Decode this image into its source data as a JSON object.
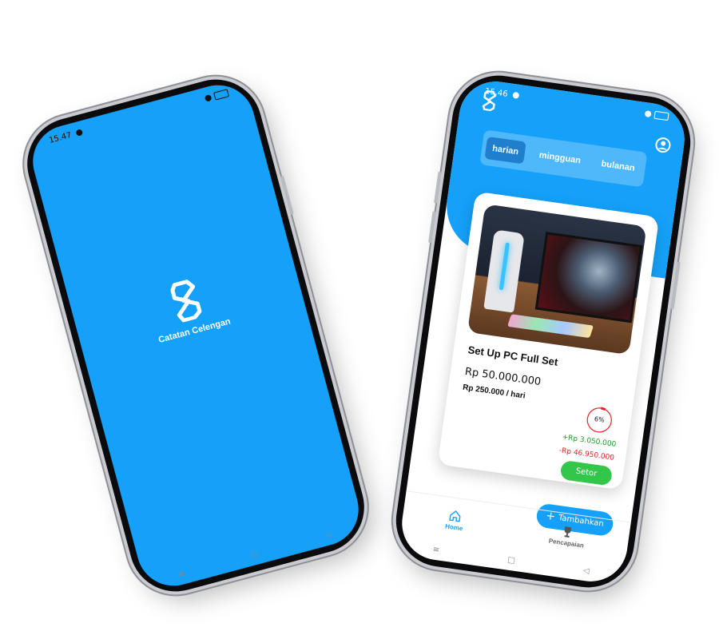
{
  "splash": {
    "status_time": "15.47",
    "app_name": "Catatan Celengan",
    "icon": "app-logo-icon"
  },
  "home": {
    "status_time": "15.46",
    "tabs": [
      {
        "label": "harian",
        "active": true
      },
      {
        "label": "mingguan",
        "active": false
      },
      {
        "label": "bulanan",
        "active": false
      }
    ],
    "card": {
      "title": "Set Up PC Full Set",
      "target": "Rp 50.000.000",
      "daily": "Rp 250.000 / hari",
      "progress_percent": 6,
      "progress_label": "6%",
      "saved": "+Rp 3.050.000",
      "remaining": "-Rp 46.950.000",
      "deposit_label": "Setor"
    },
    "add_label": "Tambahkan",
    "nav": [
      {
        "label": "Home",
        "icon": "home-icon",
        "active": true
      },
      {
        "label": "Pencapaian",
        "icon": "trophy-icon",
        "active": false
      }
    ],
    "colors": {
      "primary": "#15a1f9",
      "success": "#32c64a",
      "danger": "#e0262b"
    }
  }
}
